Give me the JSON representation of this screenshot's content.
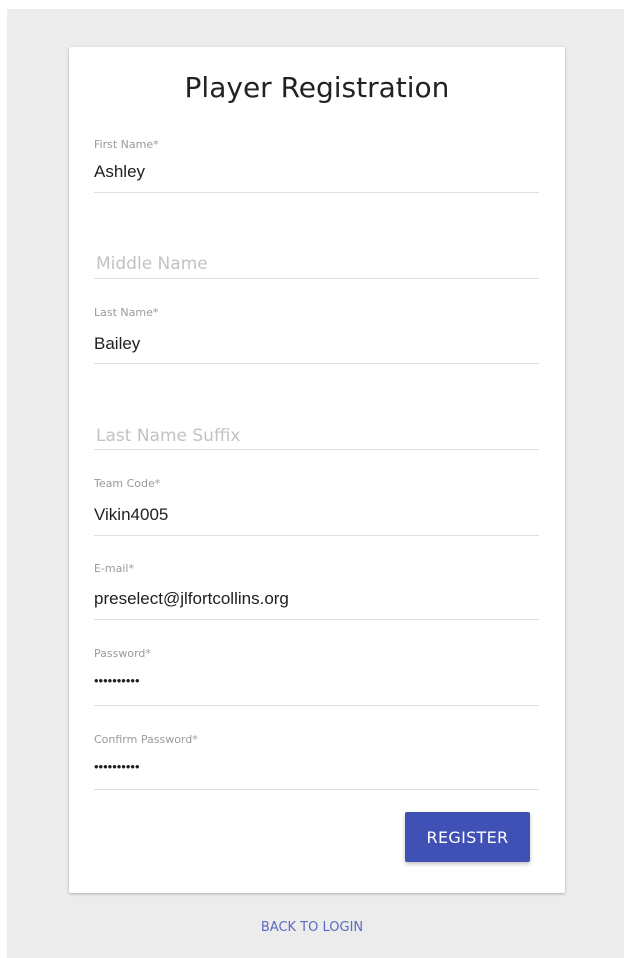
{
  "form": {
    "title": "Player Registration",
    "fields": [
      {
        "label": "First Name*",
        "value": "Ashley",
        "placeholder": ""
      },
      {
        "label": "",
        "value": "",
        "placeholder": "Middle Name"
      },
      {
        "label": "Last Name*",
        "value": "Bailey",
        "placeholder": ""
      },
      {
        "label": "",
        "value": "",
        "placeholder": "Last Name Suffix"
      },
      {
        "label": "Team Code*",
        "value": "Vikin4005",
        "placeholder": ""
      },
      {
        "label": "E-mail*",
        "value": "preselect@jlfortcollins.org",
        "placeholder": ""
      },
      {
        "label": "Password*",
        "value": "••••••••••",
        "placeholder": ""
      },
      {
        "label": "Confirm Password*",
        "value": "••••••••••",
        "placeholder": ""
      }
    ],
    "register_label": "REGISTER",
    "back_to_login_label": "BACK TO LOGIN"
  },
  "colors": {
    "primary": "#3f51b5",
    "link": "#5c6bc0",
    "background": "#ececec"
  }
}
